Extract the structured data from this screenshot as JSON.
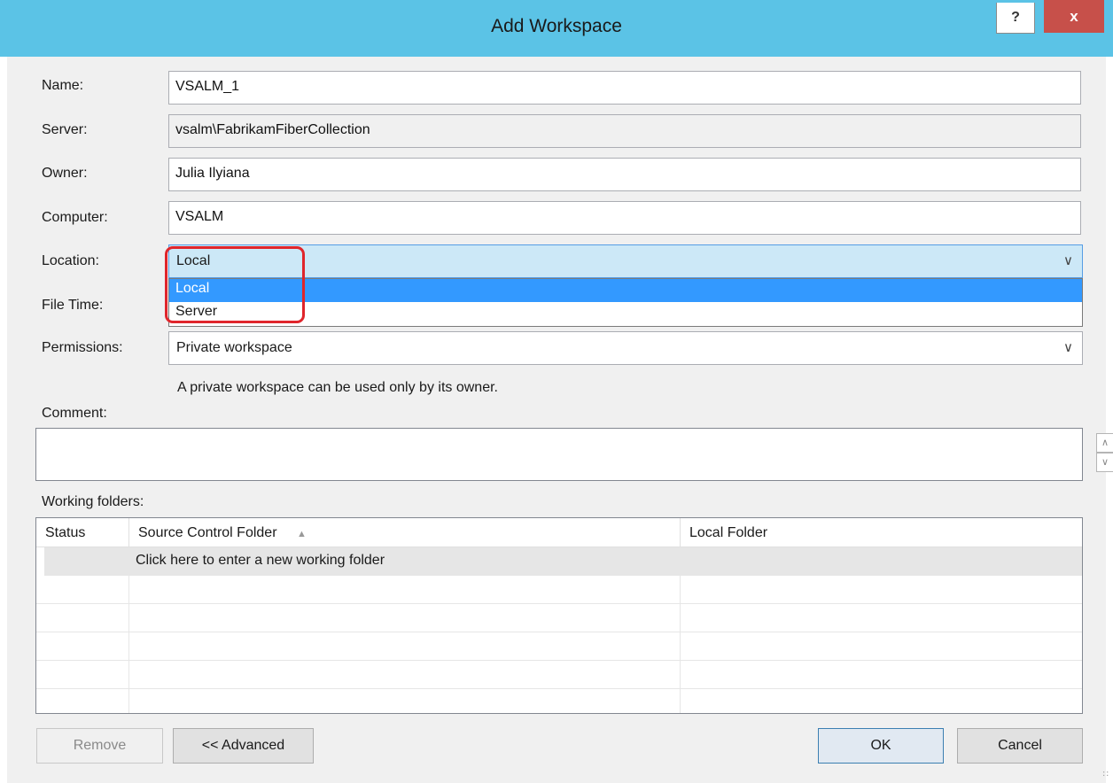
{
  "window": {
    "title": "Add Workspace",
    "help_glyph": "?",
    "close_glyph": "x"
  },
  "form": {
    "name_label": "Name:",
    "name_value": "VSALM_1",
    "server_label": "Server:",
    "server_value": "vsalm\\FabrikamFiberCollection",
    "owner_label": "Owner:",
    "owner_value": "Julia Ilyiana",
    "computer_label": "Computer:",
    "computer_value": "VSALM",
    "location_label": "Location:",
    "location_value": "Local",
    "location_options": [
      "Local",
      "Server"
    ],
    "filetime_label": "File Time:",
    "permissions_label": "Permissions:",
    "permissions_value": "Private workspace",
    "permissions_hint": "A private workspace can be used only by its owner.",
    "comment_label": "Comment:",
    "comment_value": ""
  },
  "working_folders": {
    "label": "Working folders:",
    "columns": [
      "Status",
      "Source Control Folder",
      "Local Folder"
    ],
    "sort_glyph": "▲",
    "new_row_text": "Click here to enter a new working folder"
  },
  "buttons": {
    "remove": "Remove",
    "advanced": "<< Advanced",
    "ok": "OK",
    "cancel": "Cancel"
  },
  "colors": {
    "titlebar": "#5bc3e6",
    "close": "#c7504a",
    "selection": "#3399ff",
    "highlight_annotation": "#e0252b"
  }
}
